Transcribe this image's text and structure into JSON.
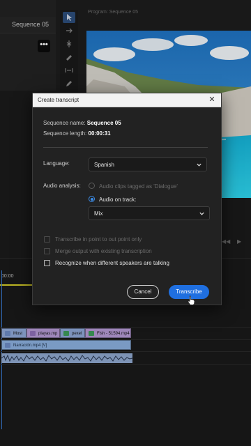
{
  "app": {
    "sequence_tab": "Sequence 05",
    "program_monitor_title": "Program: Sequence 05",
    "timecode": "00:00",
    "tools": [
      "selection-tool-icon",
      "track-select-icon",
      "ripple-edit-icon",
      "razor-icon",
      "slip-icon",
      "pen-icon"
    ]
  },
  "timeline": {
    "clips": [
      {
        "label": "Most",
        "color": "#8fa8d6"
      },
      {
        "label": "playas.mp",
        "color": "#b59ad4"
      },
      {
        "label": "pexel",
        "color": "#8fa8d6"
      },
      {
        "label": "Fish - 51594.mp4",
        "color": "#b59ad4"
      }
    ],
    "narration_clip": "Narración.mp4 [V]"
  },
  "dialog": {
    "title": "Create transcript",
    "sequence_name_label": "Sequence name:",
    "sequence_name_value": "Sequence 05",
    "sequence_length_label": "Sequence length:",
    "sequence_length_value": "00:00:31",
    "language_label": "Language:",
    "language_value": "Spanish",
    "audio_analysis_label": "Audio analysis:",
    "radio_dialogue": "Audio clips tagged as 'Dialogue'",
    "radio_track": "Audio on track:",
    "track_value": "Mix",
    "check_in_out": "Transcribe in point to out point only",
    "check_merge": "Merge output with existing transcription",
    "check_speakers": "Recognize when different speakers are talking",
    "cancel_label": "Cancel",
    "transcribe_label": "Transcribe",
    "accent": "#1f6fe0"
  }
}
